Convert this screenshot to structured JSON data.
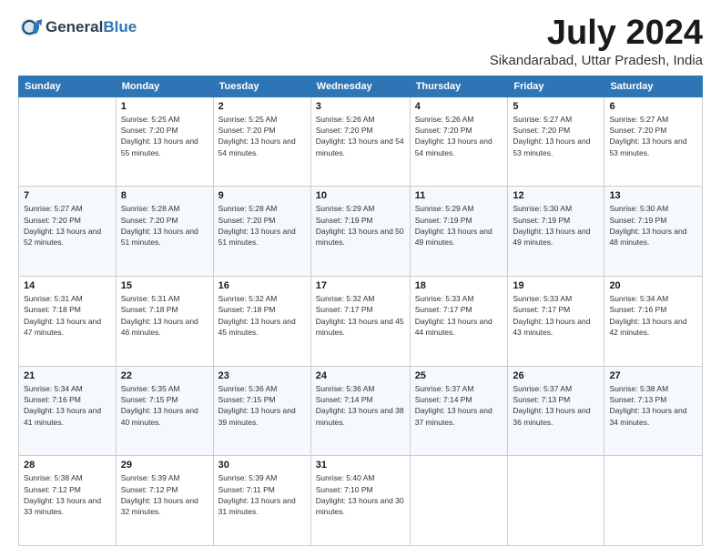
{
  "logo": {
    "general": "General",
    "blue": "Blue"
  },
  "title": "July 2024",
  "location": "Sikandarabad, Uttar Pradesh, India",
  "days_of_week": [
    "Sunday",
    "Monday",
    "Tuesday",
    "Wednesday",
    "Thursday",
    "Friday",
    "Saturday"
  ],
  "weeks": [
    [
      {
        "day": "",
        "sunrise": "",
        "sunset": "",
        "daylight": ""
      },
      {
        "day": "1",
        "sunrise": "Sunrise: 5:25 AM",
        "sunset": "Sunset: 7:20 PM",
        "daylight": "Daylight: 13 hours and 55 minutes."
      },
      {
        "day": "2",
        "sunrise": "Sunrise: 5:25 AM",
        "sunset": "Sunset: 7:20 PM",
        "daylight": "Daylight: 13 hours and 54 minutes."
      },
      {
        "day": "3",
        "sunrise": "Sunrise: 5:26 AM",
        "sunset": "Sunset: 7:20 PM",
        "daylight": "Daylight: 13 hours and 54 minutes."
      },
      {
        "day": "4",
        "sunrise": "Sunrise: 5:26 AM",
        "sunset": "Sunset: 7:20 PM",
        "daylight": "Daylight: 13 hours and 54 minutes."
      },
      {
        "day": "5",
        "sunrise": "Sunrise: 5:27 AM",
        "sunset": "Sunset: 7:20 PM",
        "daylight": "Daylight: 13 hours and 53 minutes."
      },
      {
        "day": "6",
        "sunrise": "Sunrise: 5:27 AM",
        "sunset": "Sunset: 7:20 PM",
        "daylight": "Daylight: 13 hours and 53 minutes."
      }
    ],
    [
      {
        "day": "7",
        "sunrise": "Sunrise: 5:27 AM",
        "sunset": "Sunset: 7:20 PM",
        "daylight": "Daylight: 13 hours and 52 minutes."
      },
      {
        "day": "8",
        "sunrise": "Sunrise: 5:28 AM",
        "sunset": "Sunset: 7:20 PM",
        "daylight": "Daylight: 13 hours and 51 minutes."
      },
      {
        "day": "9",
        "sunrise": "Sunrise: 5:28 AM",
        "sunset": "Sunset: 7:20 PM",
        "daylight": "Daylight: 13 hours and 51 minutes."
      },
      {
        "day": "10",
        "sunrise": "Sunrise: 5:29 AM",
        "sunset": "Sunset: 7:19 PM",
        "daylight": "Daylight: 13 hours and 50 minutes."
      },
      {
        "day": "11",
        "sunrise": "Sunrise: 5:29 AM",
        "sunset": "Sunset: 7:19 PM",
        "daylight": "Daylight: 13 hours and 49 minutes."
      },
      {
        "day": "12",
        "sunrise": "Sunrise: 5:30 AM",
        "sunset": "Sunset: 7:19 PM",
        "daylight": "Daylight: 13 hours and 49 minutes."
      },
      {
        "day": "13",
        "sunrise": "Sunrise: 5:30 AM",
        "sunset": "Sunset: 7:19 PM",
        "daylight": "Daylight: 13 hours and 48 minutes."
      }
    ],
    [
      {
        "day": "14",
        "sunrise": "Sunrise: 5:31 AM",
        "sunset": "Sunset: 7:18 PM",
        "daylight": "Daylight: 13 hours and 47 minutes."
      },
      {
        "day": "15",
        "sunrise": "Sunrise: 5:31 AM",
        "sunset": "Sunset: 7:18 PM",
        "daylight": "Daylight: 13 hours and 46 minutes."
      },
      {
        "day": "16",
        "sunrise": "Sunrise: 5:32 AM",
        "sunset": "Sunset: 7:18 PM",
        "daylight": "Daylight: 13 hours and 45 minutes."
      },
      {
        "day": "17",
        "sunrise": "Sunrise: 5:32 AM",
        "sunset": "Sunset: 7:17 PM",
        "daylight": "Daylight: 13 hours and 45 minutes."
      },
      {
        "day": "18",
        "sunrise": "Sunrise: 5:33 AM",
        "sunset": "Sunset: 7:17 PM",
        "daylight": "Daylight: 13 hours and 44 minutes."
      },
      {
        "day": "19",
        "sunrise": "Sunrise: 5:33 AM",
        "sunset": "Sunset: 7:17 PM",
        "daylight": "Daylight: 13 hours and 43 minutes."
      },
      {
        "day": "20",
        "sunrise": "Sunrise: 5:34 AM",
        "sunset": "Sunset: 7:16 PM",
        "daylight": "Daylight: 13 hours and 42 minutes."
      }
    ],
    [
      {
        "day": "21",
        "sunrise": "Sunrise: 5:34 AM",
        "sunset": "Sunset: 7:16 PM",
        "daylight": "Daylight: 13 hours and 41 minutes."
      },
      {
        "day": "22",
        "sunrise": "Sunrise: 5:35 AM",
        "sunset": "Sunset: 7:15 PM",
        "daylight": "Daylight: 13 hours and 40 minutes."
      },
      {
        "day": "23",
        "sunrise": "Sunrise: 5:36 AM",
        "sunset": "Sunset: 7:15 PM",
        "daylight": "Daylight: 13 hours and 39 minutes."
      },
      {
        "day": "24",
        "sunrise": "Sunrise: 5:36 AM",
        "sunset": "Sunset: 7:14 PM",
        "daylight": "Daylight: 13 hours and 38 minutes."
      },
      {
        "day": "25",
        "sunrise": "Sunrise: 5:37 AM",
        "sunset": "Sunset: 7:14 PM",
        "daylight": "Daylight: 13 hours and 37 minutes."
      },
      {
        "day": "26",
        "sunrise": "Sunrise: 5:37 AM",
        "sunset": "Sunset: 7:13 PM",
        "daylight": "Daylight: 13 hours and 36 minutes."
      },
      {
        "day": "27",
        "sunrise": "Sunrise: 5:38 AM",
        "sunset": "Sunset: 7:13 PM",
        "daylight": "Daylight: 13 hours and 34 minutes."
      }
    ],
    [
      {
        "day": "28",
        "sunrise": "Sunrise: 5:38 AM",
        "sunset": "Sunset: 7:12 PM",
        "daylight": "Daylight: 13 hours and 33 minutes."
      },
      {
        "day": "29",
        "sunrise": "Sunrise: 5:39 AM",
        "sunset": "Sunset: 7:12 PM",
        "daylight": "Daylight: 13 hours and 32 minutes."
      },
      {
        "day": "30",
        "sunrise": "Sunrise: 5:39 AM",
        "sunset": "Sunset: 7:11 PM",
        "daylight": "Daylight: 13 hours and 31 minutes."
      },
      {
        "day": "31",
        "sunrise": "Sunrise: 5:40 AM",
        "sunset": "Sunset: 7:10 PM",
        "daylight": "Daylight: 13 hours and 30 minutes."
      },
      {
        "day": "",
        "sunrise": "",
        "sunset": "",
        "daylight": ""
      },
      {
        "day": "",
        "sunrise": "",
        "sunset": "",
        "daylight": ""
      },
      {
        "day": "",
        "sunrise": "",
        "sunset": "",
        "daylight": ""
      }
    ]
  ]
}
